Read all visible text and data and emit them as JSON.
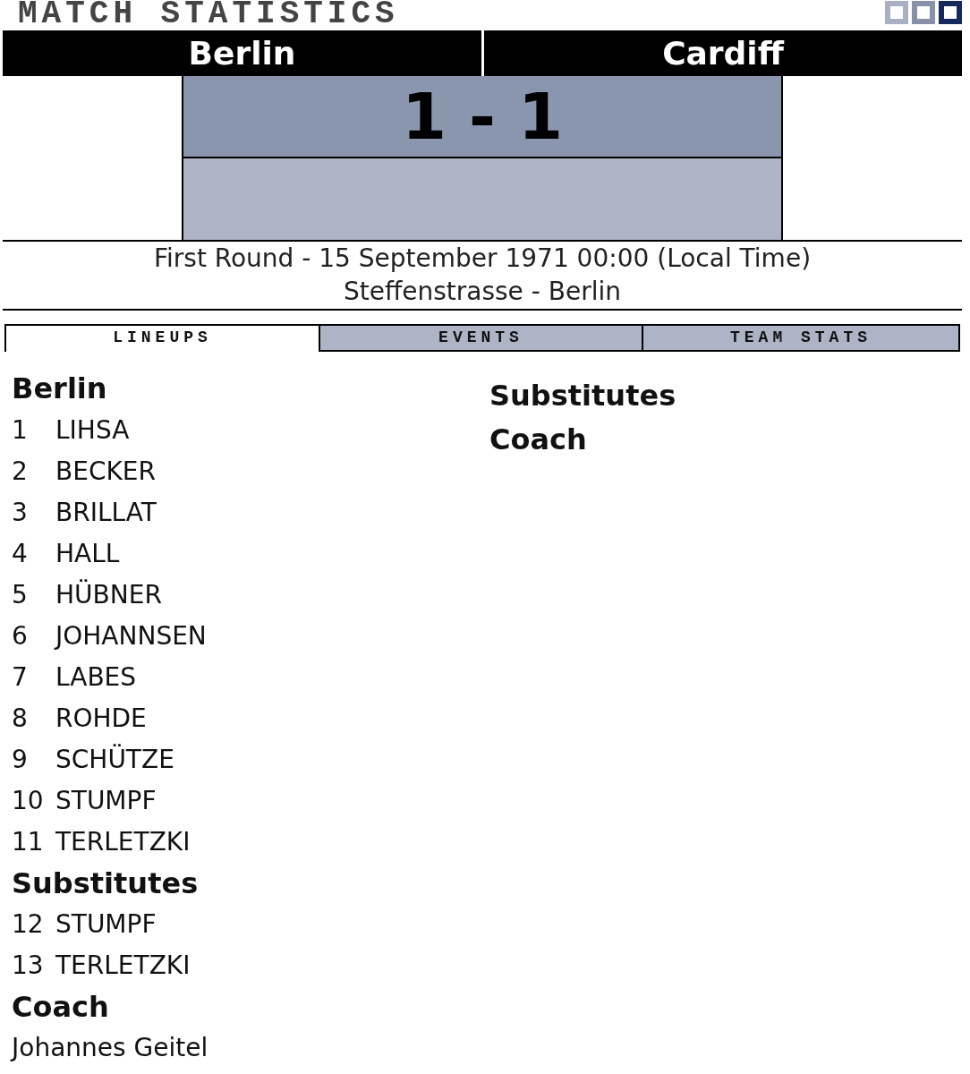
{
  "header": {
    "title": "MATCH STATISTICS",
    "theme_swatches": [
      {
        "color": "#a9b0c4"
      },
      {
        "color": "#8890aa"
      },
      {
        "color": "#15295a"
      }
    ]
  },
  "match": {
    "home_team": "Berlin",
    "away_team": "Cardiff",
    "score": "1 - 1",
    "details": "First Round - 15 September 1971 00:00 (Local Time)",
    "venue": "Steffenstrasse - Berlin"
  },
  "tabs": [
    {
      "label": "LINEUPS",
      "selected": true
    },
    {
      "label": "EVENTS",
      "selected": false
    },
    {
      "label": "TEAM STATS",
      "selected": false
    }
  ],
  "lineups": [
    {
      "team": "Berlin",
      "players": [
        {
          "number": "1",
          "name": "LIHSA"
        },
        {
          "number": "2",
          "name": "BECKER"
        },
        {
          "number": "3",
          "name": "BRILLAT"
        },
        {
          "number": "4",
          "name": "HALL"
        },
        {
          "number": "5",
          "name": "HÜBNER"
        },
        {
          "number": "6",
          "name": "JOHANNSEN"
        },
        {
          "number": "7",
          "name": "LABES"
        },
        {
          "number": "8",
          "name": "ROHDE"
        },
        {
          "number": "9",
          "name": "SCHÜTZE"
        },
        {
          "number": "10",
          "name": "STUMPF"
        },
        {
          "number": "11",
          "name": "TERLETZKI"
        }
      ],
      "substitutes_heading": "Substitutes",
      "substitutes": [
        {
          "number": "12",
          "name": "STUMPF"
        },
        {
          "number": "13",
          "name": "TERLETZKI"
        }
      ],
      "coach_heading": "Coach",
      "coach": "Johannes Geitel"
    },
    {
      "substitutes_heading": "Substitutes",
      "coach_heading": "Coach"
    }
  ]
}
